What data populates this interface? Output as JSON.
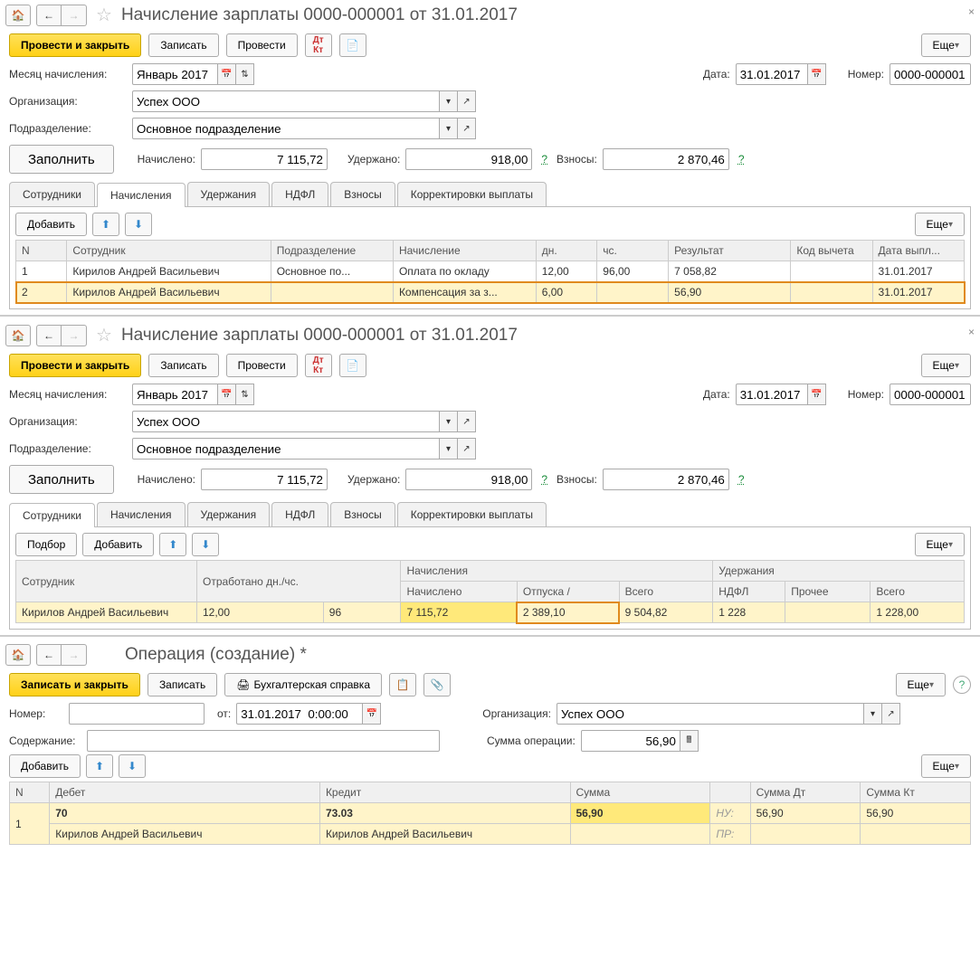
{
  "p1": {
    "title": "Начисление зарплаты 0000-000001 от 31.01.2017",
    "buttons": {
      "main": "Провести и закрыть",
      "save": "Записать",
      "post": "Провести",
      "more": "Еще"
    },
    "fields": {
      "month_lbl": "Месяц начисления:",
      "month_val": "Январь 2017",
      "date_lbl": "Дата:",
      "date_val": "31.01.2017",
      "number_lbl": "Номер:",
      "number_val": "0000-000001",
      "org_lbl": "Организация:",
      "org_val": "Успех ООО",
      "dep_lbl": "Подразделение:",
      "dep_val": "Основное подразделение",
      "fill": "Заполнить",
      "accrued_lbl": "Начислено:",
      "accrued_val": "7 115,72",
      "withheld_lbl": "Удержано:",
      "withheld_val": "918,00",
      "contrib_lbl": "Взносы:",
      "contrib_val": "2 870,46"
    },
    "tabs": [
      "Сотрудники",
      "Начисления",
      "Удержания",
      "НДФЛ",
      "Взносы",
      "Корректировки выплаты"
    ],
    "rowbar": {
      "add": "Добавить"
    },
    "headers": [
      "N",
      "Сотрудник",
      "Подразделение",
      "Начисление",
      "дн.",
      "чс.",
      "Результат",
      "Код вычета",
      "Дата выпл..."
    ],
    "rows": [
      {
        "n": "1",
        "emp": "Кирилов Андрей Васильевич",
        "dep": "Основное по...",
        "accr": "Оплата по окладу",
        "d": "12,00",
        "h": "96,00",
        "res": "7 058,82",
        "code": "",
        "date": "31.01.2017",
        "hl": false
      },
      {
        "n": "2",
        "emp": "Кирилов Андрей Васильевич",
        "dep": "",
        "accr": "Компенсация за з...",
        "d": "6,00",
        "h": "",
        "res": "56,90",
        "code": "",
        "date": "31.01.2017",
        "hl": true
      }
    ]
  },
  "p2": {
    "title": "Начисление зарплаты 0000-000001 от 31.01.2017",
    "rowbar": {
      "pick": "Подбор",
      "add": "Добавить"
    },
    "h": {
      "emp": "Сотрудник",
      "worked": "Отработано дн./чс.",
      "accrs": "Начисления",
      "accr": "Начислено",
      "vac": "Отпуска /",
      "total": "Всего",
      "withs": "Удержания",
      "ndfl": "НДФЛ",
      "other": "Прочее",
      "wtotal": "Всего"
    },
    "row": {
      "emp": "Кирилов Андрей Васильевич",
      "d": "12,00",
      "h": "96",
      "accr": "7 115,72",
      "vac": "2 389,10",
      "total": "9 504,82",
      "ndfl": "1 228",
      "other": "",
      "wtotal": "1 228,00"
    }
  },
  "p3": {
    "title": "Операция (создание) *",
    "buttons": {
      "main": "Записать и закрыть",
      "save": "Записать",
      "ref": "Бухгалтерская справка",
      "more": "Еще"
    },
    "fields": {
      "num_lbl": "Номер:",
      "num_val": "",
      "from_lbl": "от:",
      "from_val": "31.01.2017  0:00:00",
      "org_lbl": "Организация:",
      "org_val": "Успех ООО",
      "cont_lbl": "Содержание:",
      "cont_val": "",
      "sum_lbl": "Сумма операции:",
      "sum_val": "56,90"
    },
    "rowbar": {
      "add": "Добавить"
    },
    "h": {
      "n": "N",
      "deb": "Дебет",
      "cred": "Кредит",
      "sum": "Сумма",
      "sumdt": "Сумма Дт",
      "sumkt": "Сумма Кт"
    },
    "rows": [
      {
        "n": "1",
        "deb": "70",
        "cred": "73.03",
        "sum": "56,90",
        "nu": "НУ:",
        "sumdt": "56,90",
        "sumkt": "56,90"
      },
      {
        "deb": "Кирилов Андрей Васильевич",
        "cred": "Кирилов Андрей Васильевич",
        "pr": "ПР:"
      }
    ]
  }
}
